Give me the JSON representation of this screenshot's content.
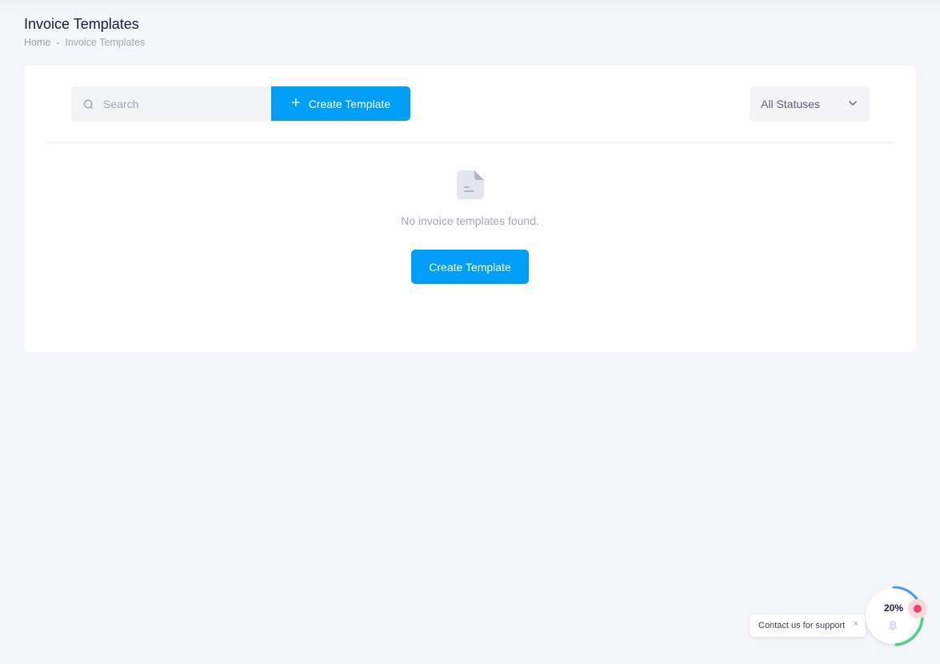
{
  "header": {
    "title": "Invoice Templates",
    "breadcrumb": {
      "home": "Home",
      "separator": "-",
      "current": "Invoice Templates"
    }
  },
  "toolbar": {
    "search_placeholder": "Search",
    "search_value": "",
    "create_label": "Create Template",
    "status_selected": "All Statuses"
  },
  "empty_state": {
    "message": "No invoice templates found.",
    "button_label": "Create Template",
    "icon": "document-icon"
  },
  "support": {
    "text": "Contact us for support",
    "close": "×"
  },
  "progress_widget": {
    "percent_label": "20%",
    "percent_value": 20,
    "icon": "bell-icon"
  },
  "colors": {
    "accent": "#009ef7",
    "background": "#f4f6fa",
    "danger": "#f1416c",
    "success": "#50cd89"
  }
}
